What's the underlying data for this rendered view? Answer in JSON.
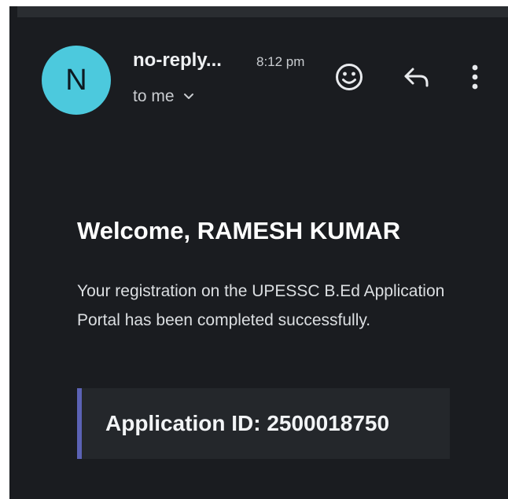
{
  "email": {
    "avatar_letter": "N",
    "sender": "no-reply...",
    "time": "8:12 pm",
    "recipient": "to me",
    "greeting": "Welcome, RAMESH KUMAR",
    "message": "Your registration on the UPESSC B.Ed Application Portal has been completed successfully.",
    "application_id": "Application ID: 2500018750"
  },
  "icons": {
    "emoji": "emoji-icon",
    "reply": "reply-icon",
    "more": "more-vertical-icon",
    "chevron": "chevron-down-icon"
  },
  "colors": {
    "background": "#1a1c20",
    "avatar": "#4cc9dd",
    "accent_bar": "#5b62b5",
    "box_background": "#24272b"
  }
}
